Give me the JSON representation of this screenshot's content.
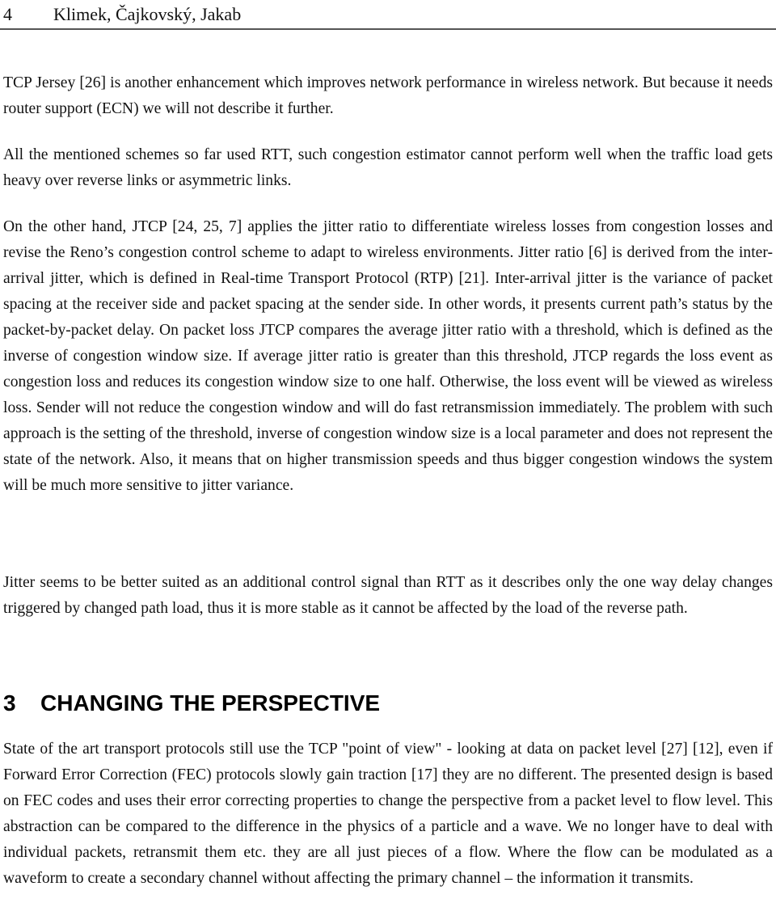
{
  "header": {
    "page_number": "4",
    "authors": "Klimek, Čajkovský, Jakab"
  },
  "paragraphs": [
    "TCP Jersey [26] is another enhancement which improves network performance in wireless network. But because it needs router support (ECN) we will not describe it further.",
    "All the mentioned schemes so far used RTT, such congestion estimator cannot perform well when the traffic load gets heavy over reverse links or asymmetric links.",
    "On the other hand, JTCP [24, 25, 7] applies the jitter ratio to differentiate wireless losses from congestion losses and revise the Reno’s congestion control scheme to adapt to wireless environments. Jitter ratio [6] is derived from the inter-arrival jitter, which is defined in Real-time Transport Protocol (RTP) [21]. Inter-arrival jitter is the variance of packet spacing at the receiver side and packet spacing at the sender side. In other words, it presents current path’s status by the packet-by-packet delay. On packet loss JTCP compares the average jitter ratio with a threshold, which is defined as the inverse of congestion window size. If average jitter ratio is greater than this threshold, JTCP regards the loss event as congestion loss and reduces its congestion window size to one half. Otherwise, the loss event will be viewed as wireless loss. Sender will not reduce the congestion window and will do fast retransmission immediately. The problem with such approach is the setting of the threshold, inverse of congestion window size is a local parameter and does not represent the state of the network. Also, it means that on higher transmission speeds and thus bigger congestion windows the system will be much more sensitive to jitter variance.",
    "Jitter seems to be better suited as an additional control signal than RTT as it describes only the one way delay changes triggered by changed path load, thus it is more stable as it cannot be affected by the load of the reverse path."
  ],
  "section": {
    "number": "3",
    "title": "CHANGING THE PERSPECTIVE",
    "paragraphs": [
      "State of the art transport protocols still use the TCP \"point of view\" - looking at data on packet level [27] [12], even if Forward Error Correction (FEC) protocols slowly gain traction [17] they are no different. The presented design is based on FEC codes and uses their error correcting properties to change the perspective from a packet level to flow level. This abstraction can be compared to the difference in the physics of a particle and a wave. We no longer have to deal with individual packets, retransmit them etc. they are all just pieces of a flow. Where the flow can be modulated as a waveform to create a secondary channel without affecting the primary channel – the information it transmits."
    ]
  }
}
